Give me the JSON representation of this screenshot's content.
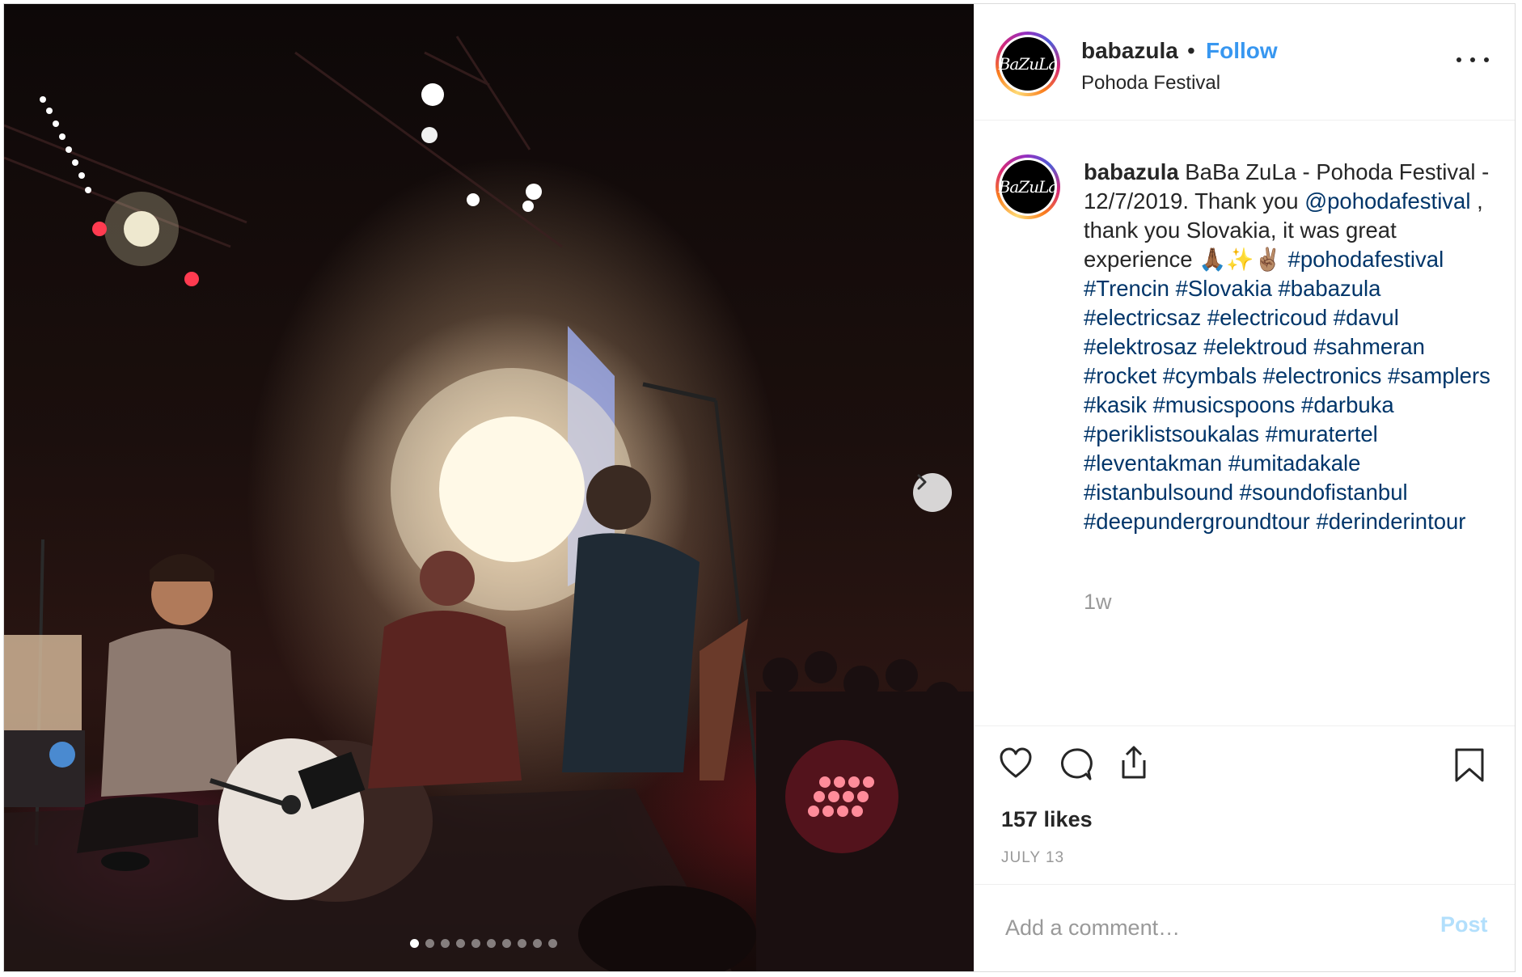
{
  "media": {
    "slide_count": 10,
    "active_slide": 1
  },
  "header": {
    "avatar_text": "BaZuLa",
    "username": "babazula",
    "separator": "•",
    "follow_label": "Follow",
    "location": "Pohoda Festival"
  },
  "caption": {
    "username": "babazula",
    "text_part1": " BaBa ZuLa - Pohoda Festival - 12/7/2019. Thank you ",
    "mention": "@pohodafestival",
    "text_part2": " , thank you Slovakia, it was great experience 🙏🏾✨✌🏽 ",
    "hashtags": [
      "#pohodafestival",
      "#Trencin",
      "#Slovakia",
      "#babazula",
      "#electricsaz",
      "#electricoud",
      "#davul",
      "#elektrosaz",
      "#elektroud",
      "#sahmeran",
      "#rocket",
      "#cymbals",
      "#electronics",
      "#samplers",
      "#kasik",
      "#musicspoons",
      "#darbuka",
      "#periklistsoukalas",
      "#muratertel",
      "#leventakman",
      "#umitadakale",
      "#istanbulsound",
      "#soundofistanbul",
      "#deepundergroundtour",
      "#derinderintour"
    ],
    "time_ago": "1w"
  },
  "actions": {
    "likes": "157 likes",
    "date": "JULY 13"
  },
  "comment": {
    "placeholder": "Add a comment…",
    "post_label": "Post"
  },
  "colors": {
    "link_blue": "#3897f0",
    "hashtag": "#003569",
    "muted": "#999999",
    "post_disabled": "#b2dffc"
  }
}
